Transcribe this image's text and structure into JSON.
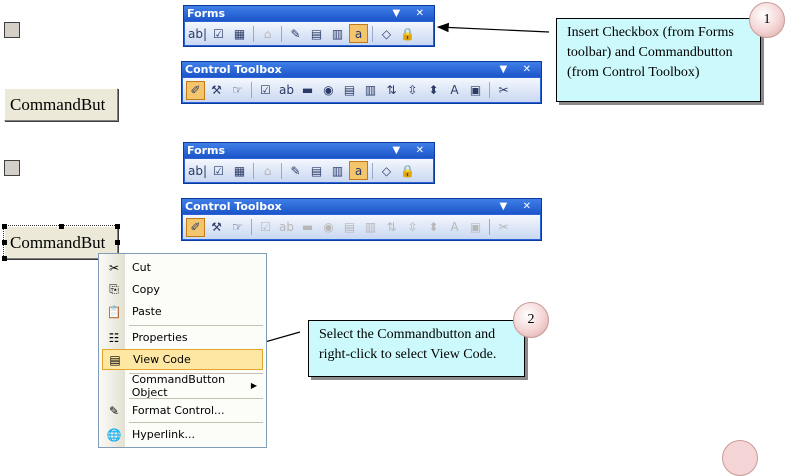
{
  "colors": {
    "toolbar_title": "#2a62d8",
    "callout_bg": "#ccf9fc",
    "menu_highlight": "#fde7a2",
    "badge": "#f4d4d4"
  },
  "sheet": {
    "command_button_top": "CommandBut",
    "command_button_bottom": "CommandBut"
  },
  "toolbars": {
    "forms_top": {
      "title": "Forms",
      "controls": "▼ ✕"
    },
    "control_top": {
      "title": "Control Toolbox",
      "controls": "▼ ✕"
    },
    "forms_bottom": {
      "title": "Forms",
      "controls": "▼ ✕"
    },
    "control_bottom": {
      "title": "Control Toolbox",
      "controls": "▼ ✕"
    },
    "forms_icons": [
      "ab|",
      "☑",
      "▦",
      "⌂",
      "✎",
      "▤",
      "▥",
      "a",
      "◇",
      "🔒"
    ],
    "control_icons": [
      "✐",
      "⚒",
      "☞",
      "☑",
      "ab",
      "▬",
      "◉",
      "▤",
      "▥",
      "⇅",
      "⇳",
      "⬍",
      "A",
      "▣",
      "✂"
    ]
  },
  "callouts": {
    "one": {
      "number": "1",
      "text": "Insert Checkbox (from Forms toolbar) and Commandbutton (from Control Toolbox)"
    },
    "two": {
      "number": "2",
      "text": "Select the Commandbutton and right-click to select View Code."
    }
  },
  "context_menu": {
    "items": [
      {
        "label": "Cut",
        "icon": "scissors-icon",
        "glyph": "✂"
      },
      {
        "label": "Copy",
        "icon": "copy-icon",
        "glyph": "⎘"
      },
      {
        "label": "Paste",
        "icon": "paste-icon",
        "glyph": "📋"
      },
      {
        "label": "Properties",
        "icon": "properties-icon",
        "glyph": "☷"
      },
      {
        "label": "View Code",
        "icon": "view-code-icon",
        "glyph": "▤"
      },
      {
        "label": "CommandButton Object",
        "icon": "",
        "glyph": ""
      },
      {
        "label": "Format Control...",
        "icon": "format-control-icon",
        "glyph": "✎"
      },
      {
        "label": "Hyperlink...",
        "icon": "hyperlink-icon",
        "glyph": "🌐"
      }
    ],
    "submenu_arrow": "▶"
  }
}
